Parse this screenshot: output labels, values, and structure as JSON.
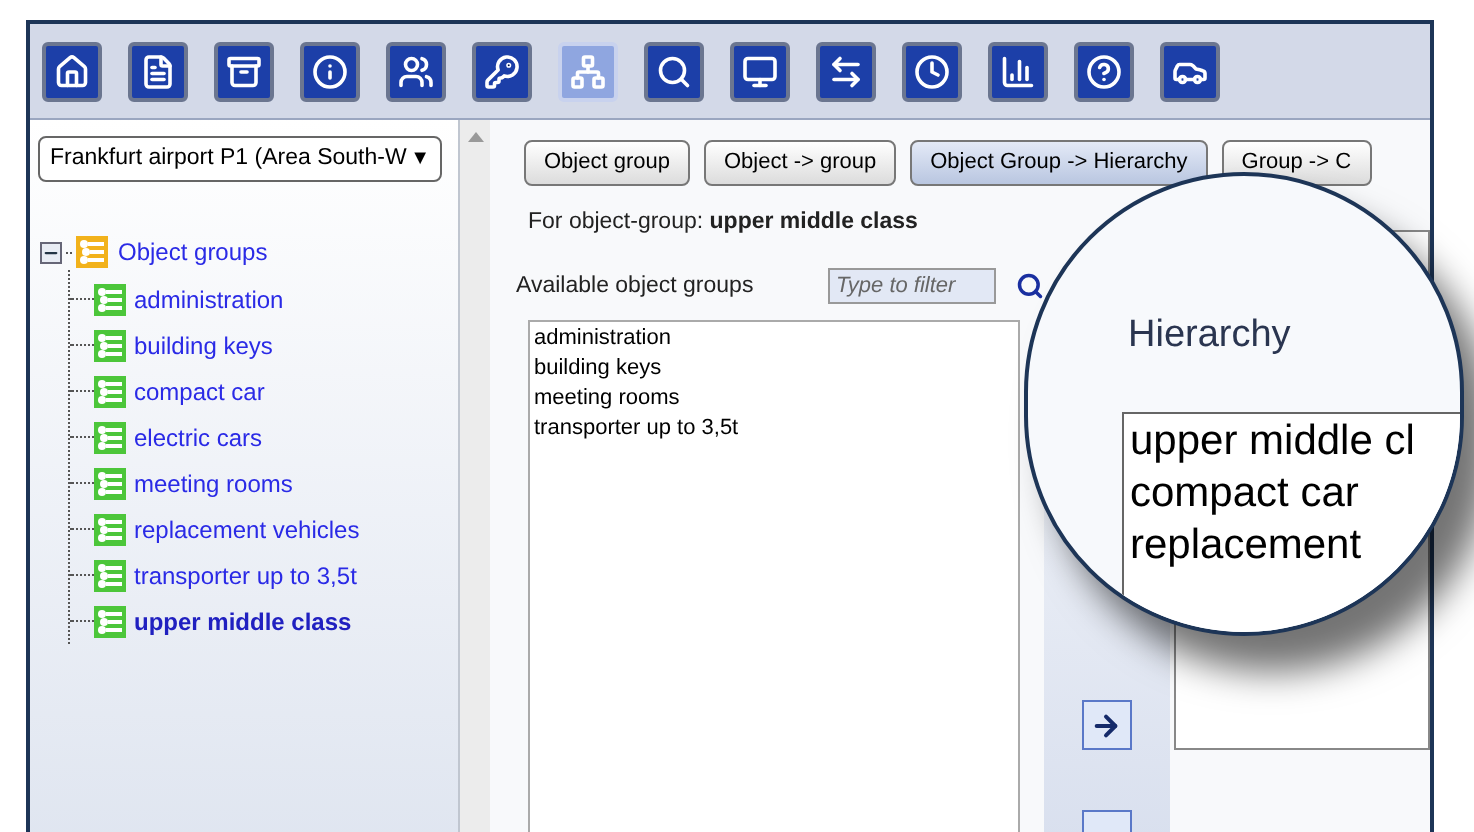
{
  "toolbar": {
    "buttons": [
      {
        "selected": false
      },
      {
        "selected": false
      },
      {
        "selected": false
      },
      {
        "selected": false
      },
      {
        "selected": false
      },
      {
        "selected": false
      },
      {
        "selected": true
      },
      {
        "selected": false
      },
      {
        "selected": false
      },
      {
        "selected": false
      },
      {
        "selected": false
      },
      {
        "selected": false
      },
      {
        "selected": false
      },
      {
        "selected": false
      }
    ]
  },
  "location_dropdown": {
    "value": "Frankfurt airport P1 (Area South-W",
    "caret": "▼"
  },
  "tree": {
    "label": "Object groups",
    "expanded": true,
    "children": [
      {
        "label": "administration",
        "selected": false
      },
      {
        "label": "building keys",
        "selected": false
      },
      {
        "label": "compact car",
        "selected": false
      },
      {
        "label": "electric cars",
        "selected": false
      },
      {
        "label": "meeting rooms",
        "selected": false
      },
      {
        "label": "replacement vehicles",
        "selected": false
      },
      {
        "label": "transporter up to 3,5t",
        "selected": false
      },
      {
        "label": "upper middle class",
        "selected": true
      }
    ]
  },
  "tabs": [
    {
      "label": "Object group",
      "selected": false
    },
    {
      "label": "Object -> group",
      "selected": false
    },
    {
      "label": "Object Group -> Hierarchy",
      "selected": true
    },
    {
      "label": "Group -> C",
      "selected": false
    }
  ],
  "context": "For object-group: **upper middle class**",
  "available": {
    "label": "Available object groups",
    "filter_placeholder": "Type to filter",
    "items": [
      "administration",
      "building keys",
      "meeting rooms",
      "transporter up to 3,5t"
    ]
  },
  "magnifier": {
    "heading": "Hierarchy",
    "items": [
      "upper middle cl",
      "compact car",
      "replacement"
    ]
  }
}
